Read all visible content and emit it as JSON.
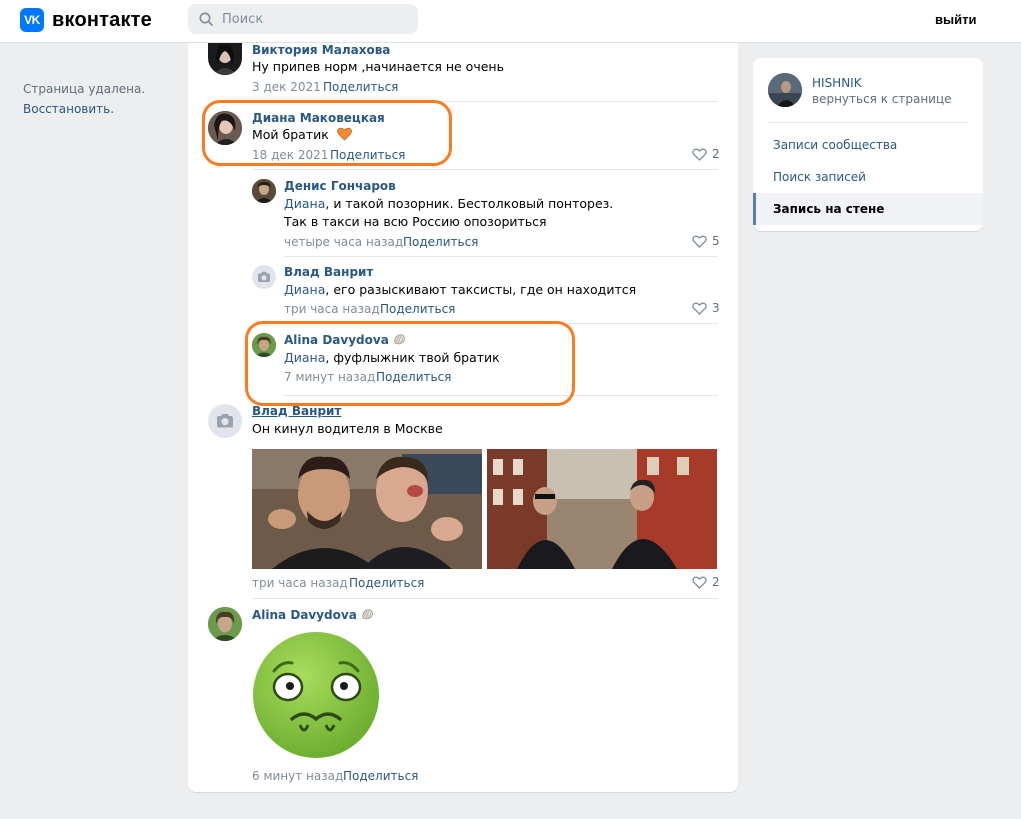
{
  "header": {
    "logo_text": "вконтакте",
    "logo_mark": "VK",
    "search_placeholder": "Поиск",
    "logout": "выйти"
  },
  "left": {
    "deleted_text": "Страница удалена.",
    "restore_link": "Восстановить."
  },
  "comments": [
    {
      "name": "Виктория Малахова",
      "text": "Ну припев норм ,начинается не очень",
      "date": "3 дек 2021",
      "share": "Поделиться"
    },
    {
      "name": "Диана Маковецкая",
      "text": "Мой братик",
      "date": "18 дек 2021",
      "share": "Поделиться",
      "likes": "2"
    },
    {
      "name": "Денис Гончаров",
      "mention": "Диана",
      "text_line1": ", и такой позорник. Бестолковый понторез.",
      "text_line2": "Так в такси на всю Россию опозориться",
      "date": "четыре часа назад",
      "share": "Поделиться",
      "likes": "5"
    },
    {
      "name": "Влад Ванрит",
      "mention": "Диана",
      "text": ", его разыскивают таксисты, где он находится",
      "date": "три часа назад",
      "share": "Поделиться",
      "likes": "3"
    },
    {
      "name": "Alina Davydova",
      "mention": "Диана",
      "text": ", фуфлыжник твой братик",
      "date": "7 минут назад",
      "share": "Поделиться"
    },
    {
      "name": "Влад Ванрит",
      "text": "Он кинул водителя в Москве",
      "date": "три часа назад",
      "share": "Поделиться",
      "likes": "2"
    },
    {
      "name": "Alina Davydova",
      "date": "6 минут назад",
      "share": "Поделиться"
    }
  ],
  "sidebar": {
    "profile_name": "HISHNIK",
    "back_link": "вернуться к странице",
    "items": [
      {
        "label": "Записи сообщества"
      },
      {
        "label": "Поиск записей"
      },
      {
        "label": "Запись на стене"
      }
    ]
  },
  "colors": {
    "link": "#2a5885",
    "highlight": "#ff7a1f",
    "background": "#edeef0"
  }
}
